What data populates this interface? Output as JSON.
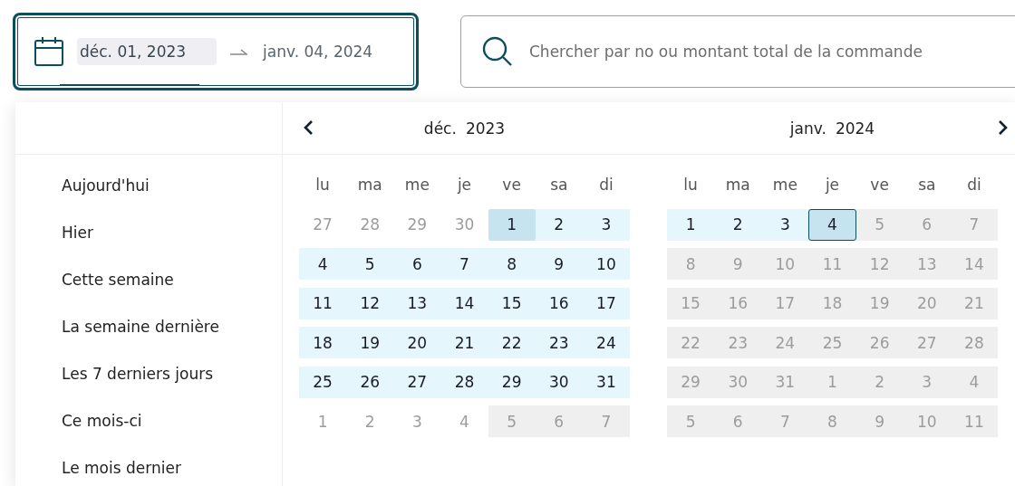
{
  "date_range": {
    "start": {
      "value": "déc. 01, 2023",
      "active": true
    },
    "end": {
      "value": "janv. 04, 2024",
      "active": false
    }
  },
  "search": {
    "placeholder": "Chercher par no ou montant total de la commande"
  },
  "presets": [
    "Aujourd'hui",
    "Hier",
    "Cette semaine",
    "La semaine dernière",
    "Les 7 derniers jours",
    "Ce mois-ci",
    "Le mois dernier"
  ],
  "months": [
    {
      "month": "déc.",
      "year": "2023",
      "weekdays": [
        "lu",
        "ma",
        "me",
        "je",
        "ve",
        "sa",
        "di"
      ],
      "weeks": [
        [
          {
            "day": "27",
            "muted": true,
            "in_range": false,
            "selected": false,
            "disabled": false
          },
          {
            "day": "28",
            "muted": true,
            "in_range": false,
            "selected": false,
            "disabled": false
          },
          {
            "day": "29",
            "muted": true,
            "in_range": false,
            "selected": false,
            "disabled": false
          },
          {
            "day": "30",
            "muted": true,
            "in_range": false,
            "selected": false,
            "disabled": false
          },
          {
            "day": "1",
            "muted": false,
            "in_range": true,
            "selected": true,
            "disabled": false
          },
          {
            "day": "2",
            "muted": false,
            "in_range": true,
            "selected": false,
            "disabled": false
          },
          {
            "day": "3",
            "muted": false,
            "in_range": true,
            "selected": false,
            "disabled": false
          }
        ],
        [
          {
            "day": "4",
            "muted": false,
            "in_range": true,
            "selected": false,
            "disabled": false
          },
          {
            "day": "5",
            "muted": false,
            "in_range": true,
            "selected": false,
            "disabled": false
          },
          {
            "day": "6",
            "muted": false,
            "in_range": true,
            "selected": false,
            "disabled": false
          },
          {
            "day": "7",
            "muted": false,
            "in_range": true,
            "selected": false,
            "disabled": false
          },
          {
            "day": "8",
            "muted": false,
            "in_range": true,
            "selected": false,
            "disabled": false
          },
          {
            "day": "9",
            "muted": false,
            "in_range": true,
            "selected": false,
            "disabled": false
          },
          {
            "day": "10",
            "muted": false,
            "in_range": true,
            "selected": false,
            "disabled": false
          }
        ],
        [
          {
            "day": "11",
            "muted": false,
            "in_range": true,
            "selected": false,
            "disabled": false
          },
          {
            "day": "12",
            "muted": false,
            "in_range": true,
            "selected": false,
            "disabled": false
          },
          {
            "day": "13",
            "muted": false,
            "in_range": true,
            "selected": false,
            "disabled": false
          },
          {
            "day": "14",
            "muted": false,
            "in_range": true,
            "selected": false,
            "disabled": false
          },
          {
            "day": "15",
            "muted": false,
            "in_range": true,
            "selected": false,
            "disabled": false
          },
          {
            "day": "16",
            "muted": false,
            "in_range": true,
            "selected": false,
            "disabled": false
          },
          {
            "day": "17",
            "muted": false,
            "in_range": true,
            "selected": false,
            "disabled": false
          }
        ],
        [
          {
            "day": "18",
            "muted": false,
            "in_range": true,
            "selected": false,
            "disabled": false
          },
          {
            "day": "19",
            "muted": false,
            "in_range": true,
            "selected": false,
            "disabled": false
          },
          {
            "day": "20",
            "muted": false,
            "in_range": true,
            "selected": false,
            "disabled": false
          },
          {
            "day": "21",
            "muted": false,
            "in_range": true,
            "selected": false,
            "disabled": false
          },
          {
            "day": "22",
            "muted": false,
            "in_range": true,
            "selected": false,
            "disabled": false
          },
          {
            "day": "23",
            "muted": false,
            "in_range": true,
            "selected": false,
            "disabled": false
          },
          {
            "day": "24",
            "muted": false,
            "in_range": true,
            "selected": false,
            "disabled": false
          }
        ],
        [
          {
            "day": "25",
            "muted": false,
            "in_range": true,
            "selected": false,
            "disabled": false
          },
          {
            "day": "26",
            "muted": false,
            "in_range": true,
            "selected": false,
            "disabled": false
          },
          {
            "day": "27",
            "muted": false,
            "in_range": true,
            "selected": false,
            "disabled": false
          },
          {
            "day": "28",
            "muted": false,
            "in_range": true,
            "selected": false,
            "disabled": false
          },
          {
            "day": "29",
            "muted": false,
            "in_range": true,
            "selected": false,
            "disabled": false
          },
          {
            "day": "30",
            "muted": false,
            "in_range": true,
            "selected": false,
            "disabled": false
          },
          {
            "day": "31",
            "muted": false,
            "in_range": true,
            "selected": false,
            "disabled": false
          }
        ],
        [
          {
            "day": "1",
            "muted": true,
            "in_range": false,
            "selected": false,
            "disabled": false
          },
          {
            "day": "2",
            "muted": true,
            "in_range": false,
            "selected": false,
            "disabled": false
          },
          {
            "day": "3",
            "muted": true,
            "in_range": false,
            "selected": false,
            "disabled": false
          },
          {
            "day": "4",
            "muted": true,
            "in_range": false,
            "selected": false,
            "disabled": false
          },
          {
            "day": "5",
            "muted": true,
            "in_range": false,
            "selected": false,
            "disabled": true
          },
          {
            "day": "6",
            "muted": true,
            "in_range": false,
            "selected": false,
            "disabled": true
          },
          {
            "day": "7",
            "muted": true,
            "in_range": false,
            "selected": false,
            "disabled": true
          }
        ]
      ]
    },
    {
      "month": "janv.",
      "year": "2024",
      "weekdays": [
        "lu",
        "ma",
        "me",
        "je",
        "ve",
        "sa",
        "di"
      ],
      "weeks": [
        [
          {
            "day": "1",
            "muted": false,
            "in_range": true,
            "selected": false,
            "disabled": false
          },
          {
            "day": "2",
            "muted": false,
            "in_range": true,
            "selected": false,
            "disabled": false
          },
          {
            "day": "3",
            "muted": false,
            "in_range": true,
            "selected": false,
            "disabled": false
          },
          {
            "day": "4",
            "muted": false,
            "in_range": true,
            "selected": true,
            "disabled": false
          },
          {
            "day": "5",
            "muted": true,
            "in_range": false,
            "selected": false,
            "disabled": true
          },
          {
            "day": "6",
            "muted": true,
            "in_range": false,
            "selected": false,
            "disabled": true
          },
          {
            "day": "7",
            "muted": true,
            "in_range": false,
            "selected": false,
            "disabled": true
          }
        ],
        [
          {
            "day": "8",
            "muted": true,
            "in_range": false,
            "selected": false,
            "disabled": true
          },
          {
            "day": "9",
            "muted": true,
            "in_range": false,
            "selected": false,
            "disabled": true
          },
          {
            "day": "10",
            "muted": true,
            "in_range": false,
            "selected": false,
            "disabled": true
          },
          {
            "day": "11",
            "muted": true,
            "in_range": false,
            "selected": false,
            "disabled": true
          },
          {
            "day": "12",
            "muted": true,
            "in_range": false,
            "selected": false,
            "disabled": true
          },
          {
            "day": "13",
            "muted": true,
            "in_range": false,
            "selected": false,
            "disabled": true
          },
          {
            "day": "14",
            "muted": true,
            "in_range": false,
            "selected": false,
            "disabled": true
          }
        ],
        [
          {
            "day": "15",
            "muted": true,
            "in_range": false,
            "selected": false,
            "disabled": true
          },
          {
            "day": "16",
            "muted": true,
            "in_range": false,
            "selected": false,
            "disabled": true
          },
          {
            "day": "17",
            "muted": true,
            "in_range": false,
            "selected": false,
            "disabled": true
          },
          {
            "day": "18",
            "muted": true,
            "in_range": false,
            "selected": false,
            "disabled": true
          },
          {
            "day": "19",
            "muted": true,
            "in_range": false,
            "selected": false,
            "disabled": true
          },
          {
            "day": "20",
            "muted": true,
            "in_range": false,
            "selected": false,
            "disabled": true
          },
          {
            "day": "21",
            "muted": true,
            "in_range": false,
            "selected": false,
            "disabled": true
          }
        ],
        [
          {
            "day": "22",
            "muted": true,
            "in_range": false,
            "selected": false,
            "disabled": true
          },
          {
            "day": "23",
            "muted": true,
            "in_range": false,
            "selected": false,
            "disabled": true
          },
          {
            "day": "24",
            "muted": true,
            "in_range": false,
            "selected": false,
            "disabled": true
          },
          {
            "day": "25",
            "muted": true,
            "in_range": false,
            "selected": false,
            "disabled": true
          },
          {
            "day": "26",
            "muted": true,
            "in_range": false,
            "selected": false,
            "disabled": true
          },
          {
            "day": "27",
            "muted": true,
            "in_range": false,
            "selected": false,
            "disabled": true
          },
          {
            "day": "28",
            "muted": true,
            "in_range": false,
            "selected": false,
            "disabled": true
          }
        ],
        [
          {
            "day": "29",
            "muted": true,
            "in_range": false,
            "selected": false,
            "disabled": true
          },
          {
            "day": "30",
            "muted": true,
            "in_range": false,
            "selected": false,
            "disabled": true
          },
          {
            "day": "31",
            "muted": true,
            "in_range": false,
            "selected": false,
            "disabled": true
          },
          {
            "day": "1",
            "muted": true,
            "in_range": false,
            "selected": false,
            "disabled": true
          },
          {
            "day": "2",
            "muted": true,
            "in_range": false,
            "selected": false,
            "disabled": true
          },
          {
            "day": "3",
            "muted": true,
            "in_range": false,
            "selected": false,
            "disabled": true
          },
          {
            "day": "4",
            "muted": true,
            "in_range": false,
            "selected": false,
            "disabled": true
          }
        ],
        [
          {
            "day": "5",
            "muted": true,
            "in_range": false,
            "selected": false,
            "disabled": true
          },
          {
            "day": "6",
            "muted": true,
            "in_range": false,
            "selected": false,
            "disabled": true
          },
          {
            "day": "7",
            "muted": true,
            "in_range": false,
            "selected": false,
            "disabled": true
          },
          {
            "day": "8",
            "muted": true,
            "in_range": false,
            "selected": false,
            "disabled": true
          },
          {
            "day": "9",
            "muted": true,
            "in_range": false,
            "selected": false,
            "disabled": true
          },
          {
            "day": "10",
            "muted": true,
            "in_range": false,
            "selected": false,
            "disabled": true
          },
          {
            "day": "11",
            "muted": true,
            "in_range": false,
            "selected": false,
            "disabled": true
          }
        ]
      ]
    }
  ]
}
